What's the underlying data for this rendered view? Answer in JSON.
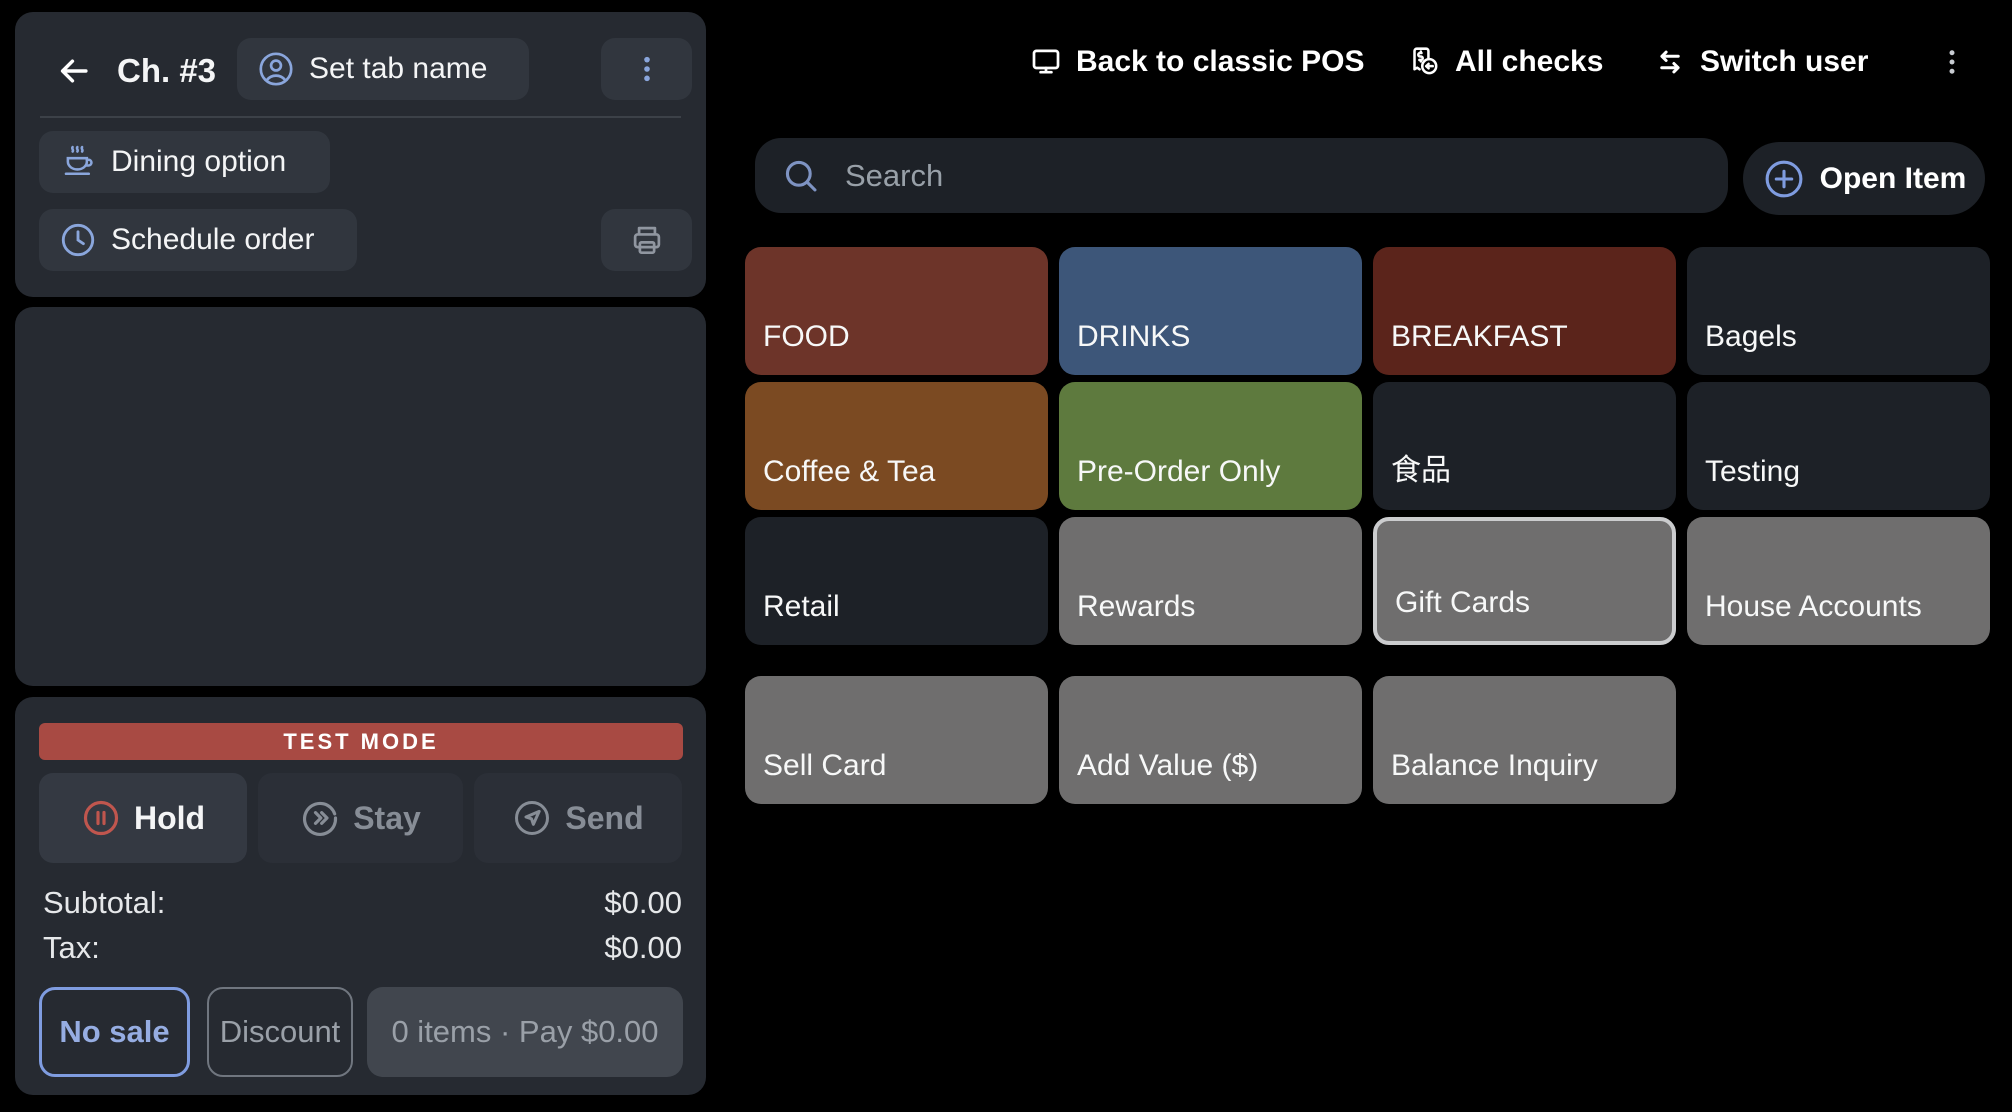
{
  "left_panel": {
    "header": {
      "title": "Ch. #3",
      "set_tab_name_label": "Set tab name"
    },
    "actions": {
      "dining_label": "Dining option",
      "schedule_label": "Schedule order"
    },
    "test_mode_label": "TEST MODE",
    "order_actions": {
      "hold": "Hold",
      "stay": "Stay",
      "send": "Send"
    },
    "totals": {
      "subtotal_label": "Subtotal:",
      "subtotal_value": "$0.00",
      "tax_label": "Tax:",
      "tax_value": "$0.00"
    },
    "footer": {
      "no_sale": "No sale",
      "discount": "Discount",
      "pay": "0 items · Pay $0.00"
    }
  },
  "top_bar": {
    "back_to_classic": "Back to classic POS",
    "all_checks": "All checks",
    "switch_user": "Switch user"
  },
  "search": {
    "placeholder": "Search",
    "value": "",
    "open_item": "Open Item"
  },
  "categories": [
    {
      "label": "FOOD",
      "color": "#6d3429"
    },
    {
      "label": "DRINKS",
      "color": "#3d5679"
    },
    {
      "label": "BREAKFAST",
      "color": "#5b241b"
    },
    {
      "label": "Bagels",
      "color": "#1d2127"
    },
    {
      "label": "Coffee & Tea",
      "color": "#7b4a22"
    },
    {
      "label": "Pre-Order Only",
      "color": "#5e7a3e"
    },
    {
      "label": "食品",
      "color": "#1d2127"
    },
    {
      "label": "Testing",
      "color": "#1d2127"
    },
    {
      "label": "Retail",
      "color": "#1d2127"
    },
    {
      "label": "Rewards",
      "color": "#6f6e6e"
    },
    {
      "label": "Gift Cards",
      "color": "#6f6e6e",
      "selected": true
    },
    {
      "label": "House Accounts",
      "color": "#6f6e6e"
    }
  ],
  "gift_card_actions": [
    {
      "label": "Sell Card",
      "color": "#6f6e6e"
    },
    {
      "label": "Add Value ($)",
      "color": "#6f6e6e"
    },
    {
      "label": "Balance Inquiry",
      "color": "#6f6e6e"
    }
  ],
  "icons": {
    "back": "arrow-left-icon",
    "set_tab": "person-circle-icon",
    "card_menu": "kebab-menu-icon",
    "dining": "steaming-cup-icon",
    "schedule": "clock-icon",
    "print": "printer-icon",
    "hold": "pause-circle-icon",
    "stay": "chevrons-circle-icon",
    "send": "send-circle-icon",
    "classic_pos": "monitor-icon",
    "all_checks": "receipt-refund-icon",
    "switch_user": "swap-arrows-icon",
    "top_menu": "kebab-menu-icon",
    "search": "search-icon",
    "open_item": "plus-circle-icon"
  },
  "colors": {
    "background": "#000000",
    "card_background": "#262a31",
    "button_background": "#31363e",
    "accent_blue": "#8aa6dc",
    "test_mode_red": "#a84a43",
    "hold_red": "#c0564e",
    "selected_tile_border": "#cbccce",
    "muted_text": "#9aa0a8"
  }
}
